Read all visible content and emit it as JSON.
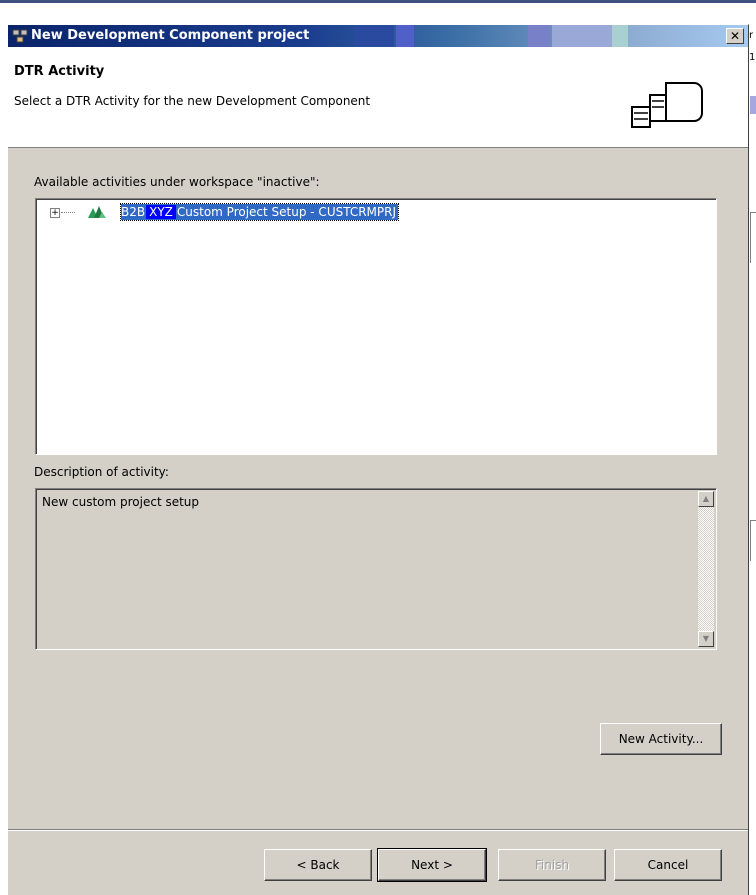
{
  "dialog": {
    "title": "New Development Component project",
    "close_glyph": "✕",
    "header": {
      "title": "DTR Activity",
      "description": "Select a DTR Activity for the new Development Component"
    },
    "activities_label": "Available activities under workspace \"inactive\":",
    "tree": {
      "expander_glyph": "+",
      "item": {
        "prefix": "B2B",
        "highlight": "XYZ",
        "suffix": "Custom Project Setup - CUSTCRMPRJ"
      }
    },
    "description_label": "Description of activity:",
    "description_text": "New custom project setup",
    "new_activity_label": "New Activity...",
    "buttons": {
      "back": "< Back",
      "next": "Next >",
      "finish": "Finish",
      "cancel": "Cancel"
    }
  },
  "background_window": {
    "fragments": [
      "r",
      "1"
    ]
  },
  "colors": {
    "selection": "#316ac5",
    "highlight": "#0000ff",
    "dialog_bg": "#d4d0c8",
    "titlebar": "#0a246a"
  }
}
